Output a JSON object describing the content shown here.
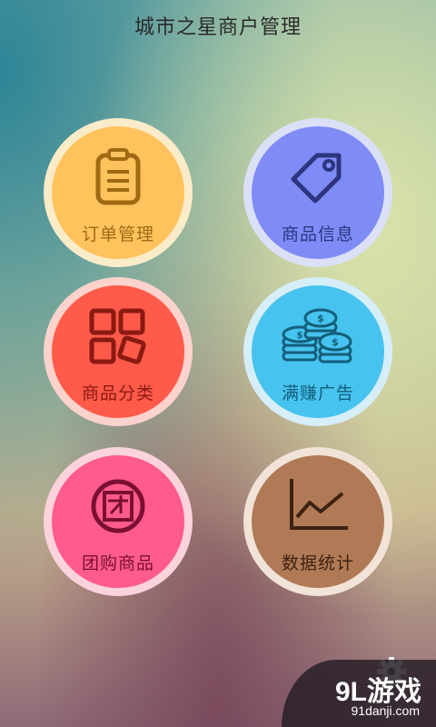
{
  "header": {
    "title": "城市之星商户管理"
  },
  "tiles": [
    {
      "label": "订单管理",
      "icon": "clipboard-icon",
      "ring": "#fbecc9",
      "fill": "#ffc35e",
      "ink": "#a06a14"
    },
    {
      "label": "商品信息",
      "icon": "price-tag-icon",
      "ring": "#dbe0f7",
      "fill": "#7f8cf6",
      "ink": "#2d3580"
    },
    {
      "label": "商品分类",
      "icon": "category-grid-icon",
      "ring": "#fbd3cc",
      "fill": "#ff5a4a",
      "ink": "#8a1a12"
    },
    {
      "label": "满赚广告",
      "icon": "coins-icon",
      "ring": "#d6eef8",
      "fill": "#46c3ee",
      "ink": "#145e7a"
    },
    {
      "label": "团购商品",
      "icon": "group-buy-icon",
      "ring": "#fbd3dc",
      "fill": "#ff5b8c",
      "ink": "#7a0f33"
    },
    {
      "label": "数据统计",
      "icon": "line-chart-icon",
      "ring": "#f1e3d7",
      "fill": "#b07a56",
      "ink": "#3e2212"
    }
  ],
  "footer": {
    "settings_icon": "gear-icon"
  },
  "watermark": {
    "text": "9L游戏",
    "sub": "91danji.com"
  }
}
